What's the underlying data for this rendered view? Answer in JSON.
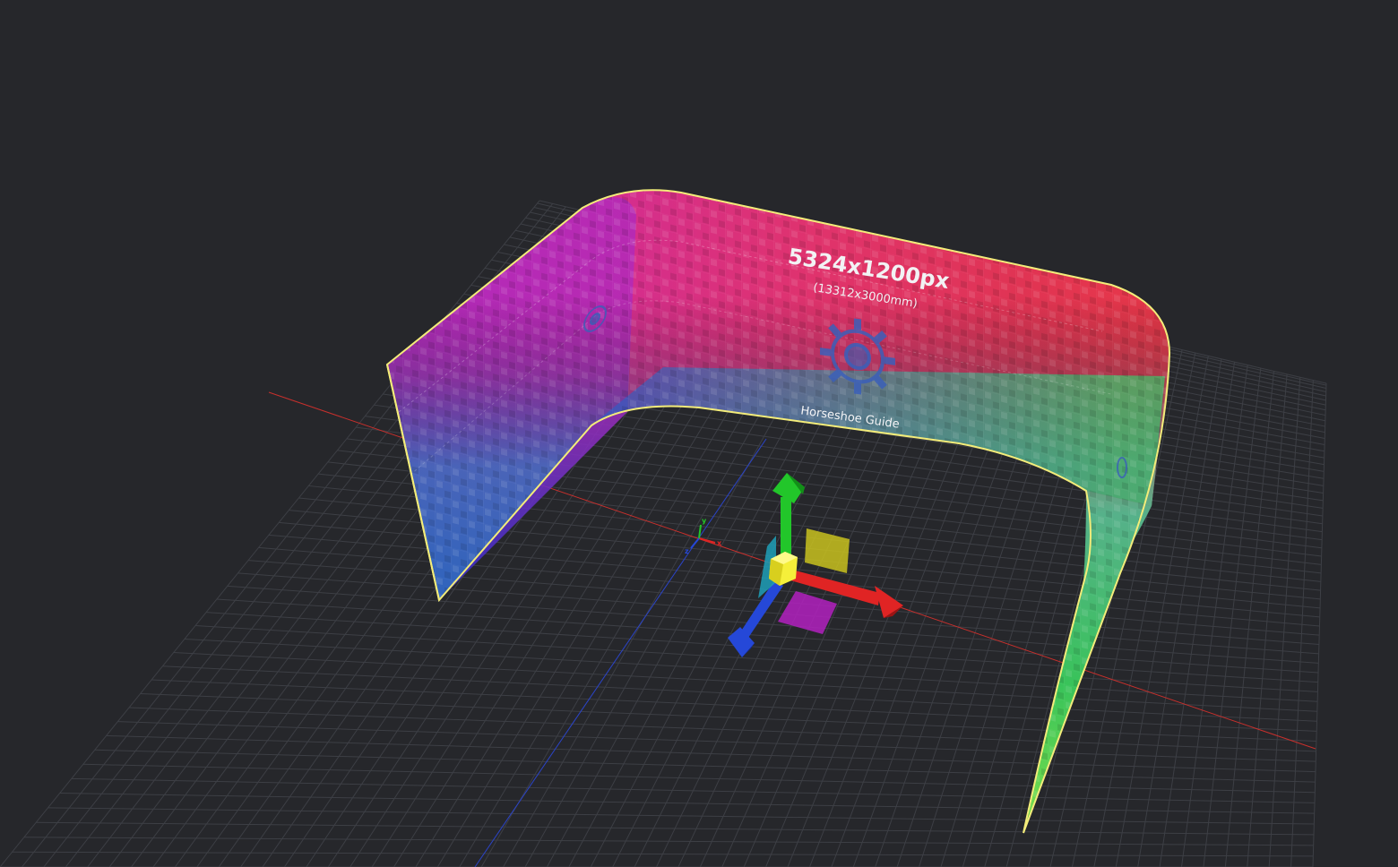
{
  "viewport": {
    "background": "#26272b",
    "grid_color": "#3d3f45",
    "x_axis_color": "#c8302c",
    "z_axis_color": "#2b44c8"
  },
  "screen": {
    "resolution_label": "5324x1200px",
    "physical_size_label": "(13312x3000mm)",
    "guide_name": "Horseshoe Guide",
    "outline_color": "#f3ec7a",
    "icon": "gear-icon"
  },
  "origin_marker": {
    "x_label": "x",
    "y_label": "y",
    "z_label": "z"
  },
  "gizmo": {
    "x_axis_color": "#e02424",
    "y_axis_color": "#22c62a",
    "z_axis_color": "#2548d8",
    "xy_plane_color": "#c9c21e",
    "xz_plane_color": "#b321c0",
    "yz_plane_color": "#1fa0b8",
    "center_color": "#f5ef3a"
  }
}
